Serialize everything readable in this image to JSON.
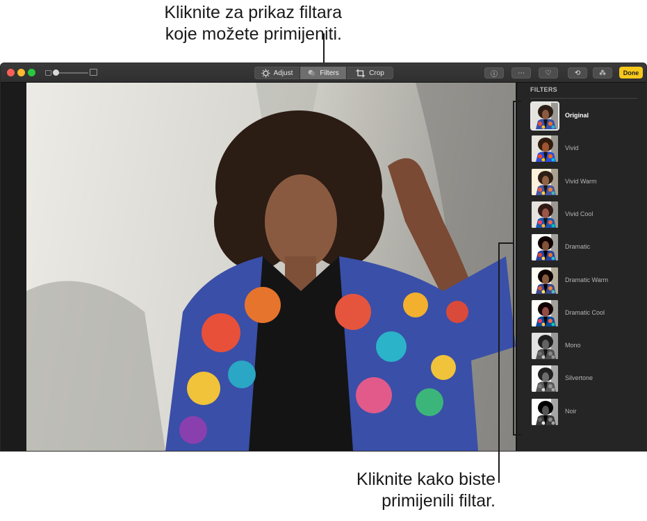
{
  "callouts": {
    "top_line1": "Kliknite za prikaz filtara",
    "top_line2": "koje možete primijeniti.",
    "bottom_line1": "Kliknite kako biste",
    "bottom_line2": "primijenili filtar."
  },
  "toolbar": {
    "tabs": [
      {
        "label": "Adjust",
        "icon": "adjust-dial-icon",
        "active": false
      },
      {
        "label": "Filters",
        "icon": "filters-circles-icon",
        "active": true
      },
      {
        "label": "Crop",
        "icon": "crop-icon",
        "active": false
      }
    ],
    "info_icon": "ⓘ",
    "more_icon": "⋯",
    "favorite_icon": "♡",
    "rotate_icon": "⟲",
    "enhance_icon": "⁂",
    "done_label": "Done",
    "accent_color": "#f6c81c"
  },
  "sidebar": {
    "title": "FILTERS",
    "filters": [
      {
        "label": "Original",
        "selected": true,
        "tint": "none"
      },
      {
        "label": "Vivid",
        "selected": false,
        "tint": "vivid"
      },
      {
        "label": "Vivid Warm",
        "selected": false,
        "tint": "warm"
      },
      {
        "label": "Vivid Cool",
        "selected": false,
        "tint": "cool"
      },
      {
        "label": "Dramatic",
        "selected": false,
        "tint": "dramatic"
      },
      {
        "label": "Dramatic Warm",
        "selected": false,
        "tint": "dramatic-warm"
      },
      {
        "label": "Dramatic Cool",
        "selected": false,
        "tint": "dramatic-cool"
      },
      {
        "label": "Mono",
        "selected": false,
        "tint": "mono"
      },
      {
        "label": "Silvertone",
        "selected": false,
        "tint": "silver"
      },
      {
        "label": "Noir",
        "selected": false,
        "tint": "noir"
      }
    ]
  }
}
